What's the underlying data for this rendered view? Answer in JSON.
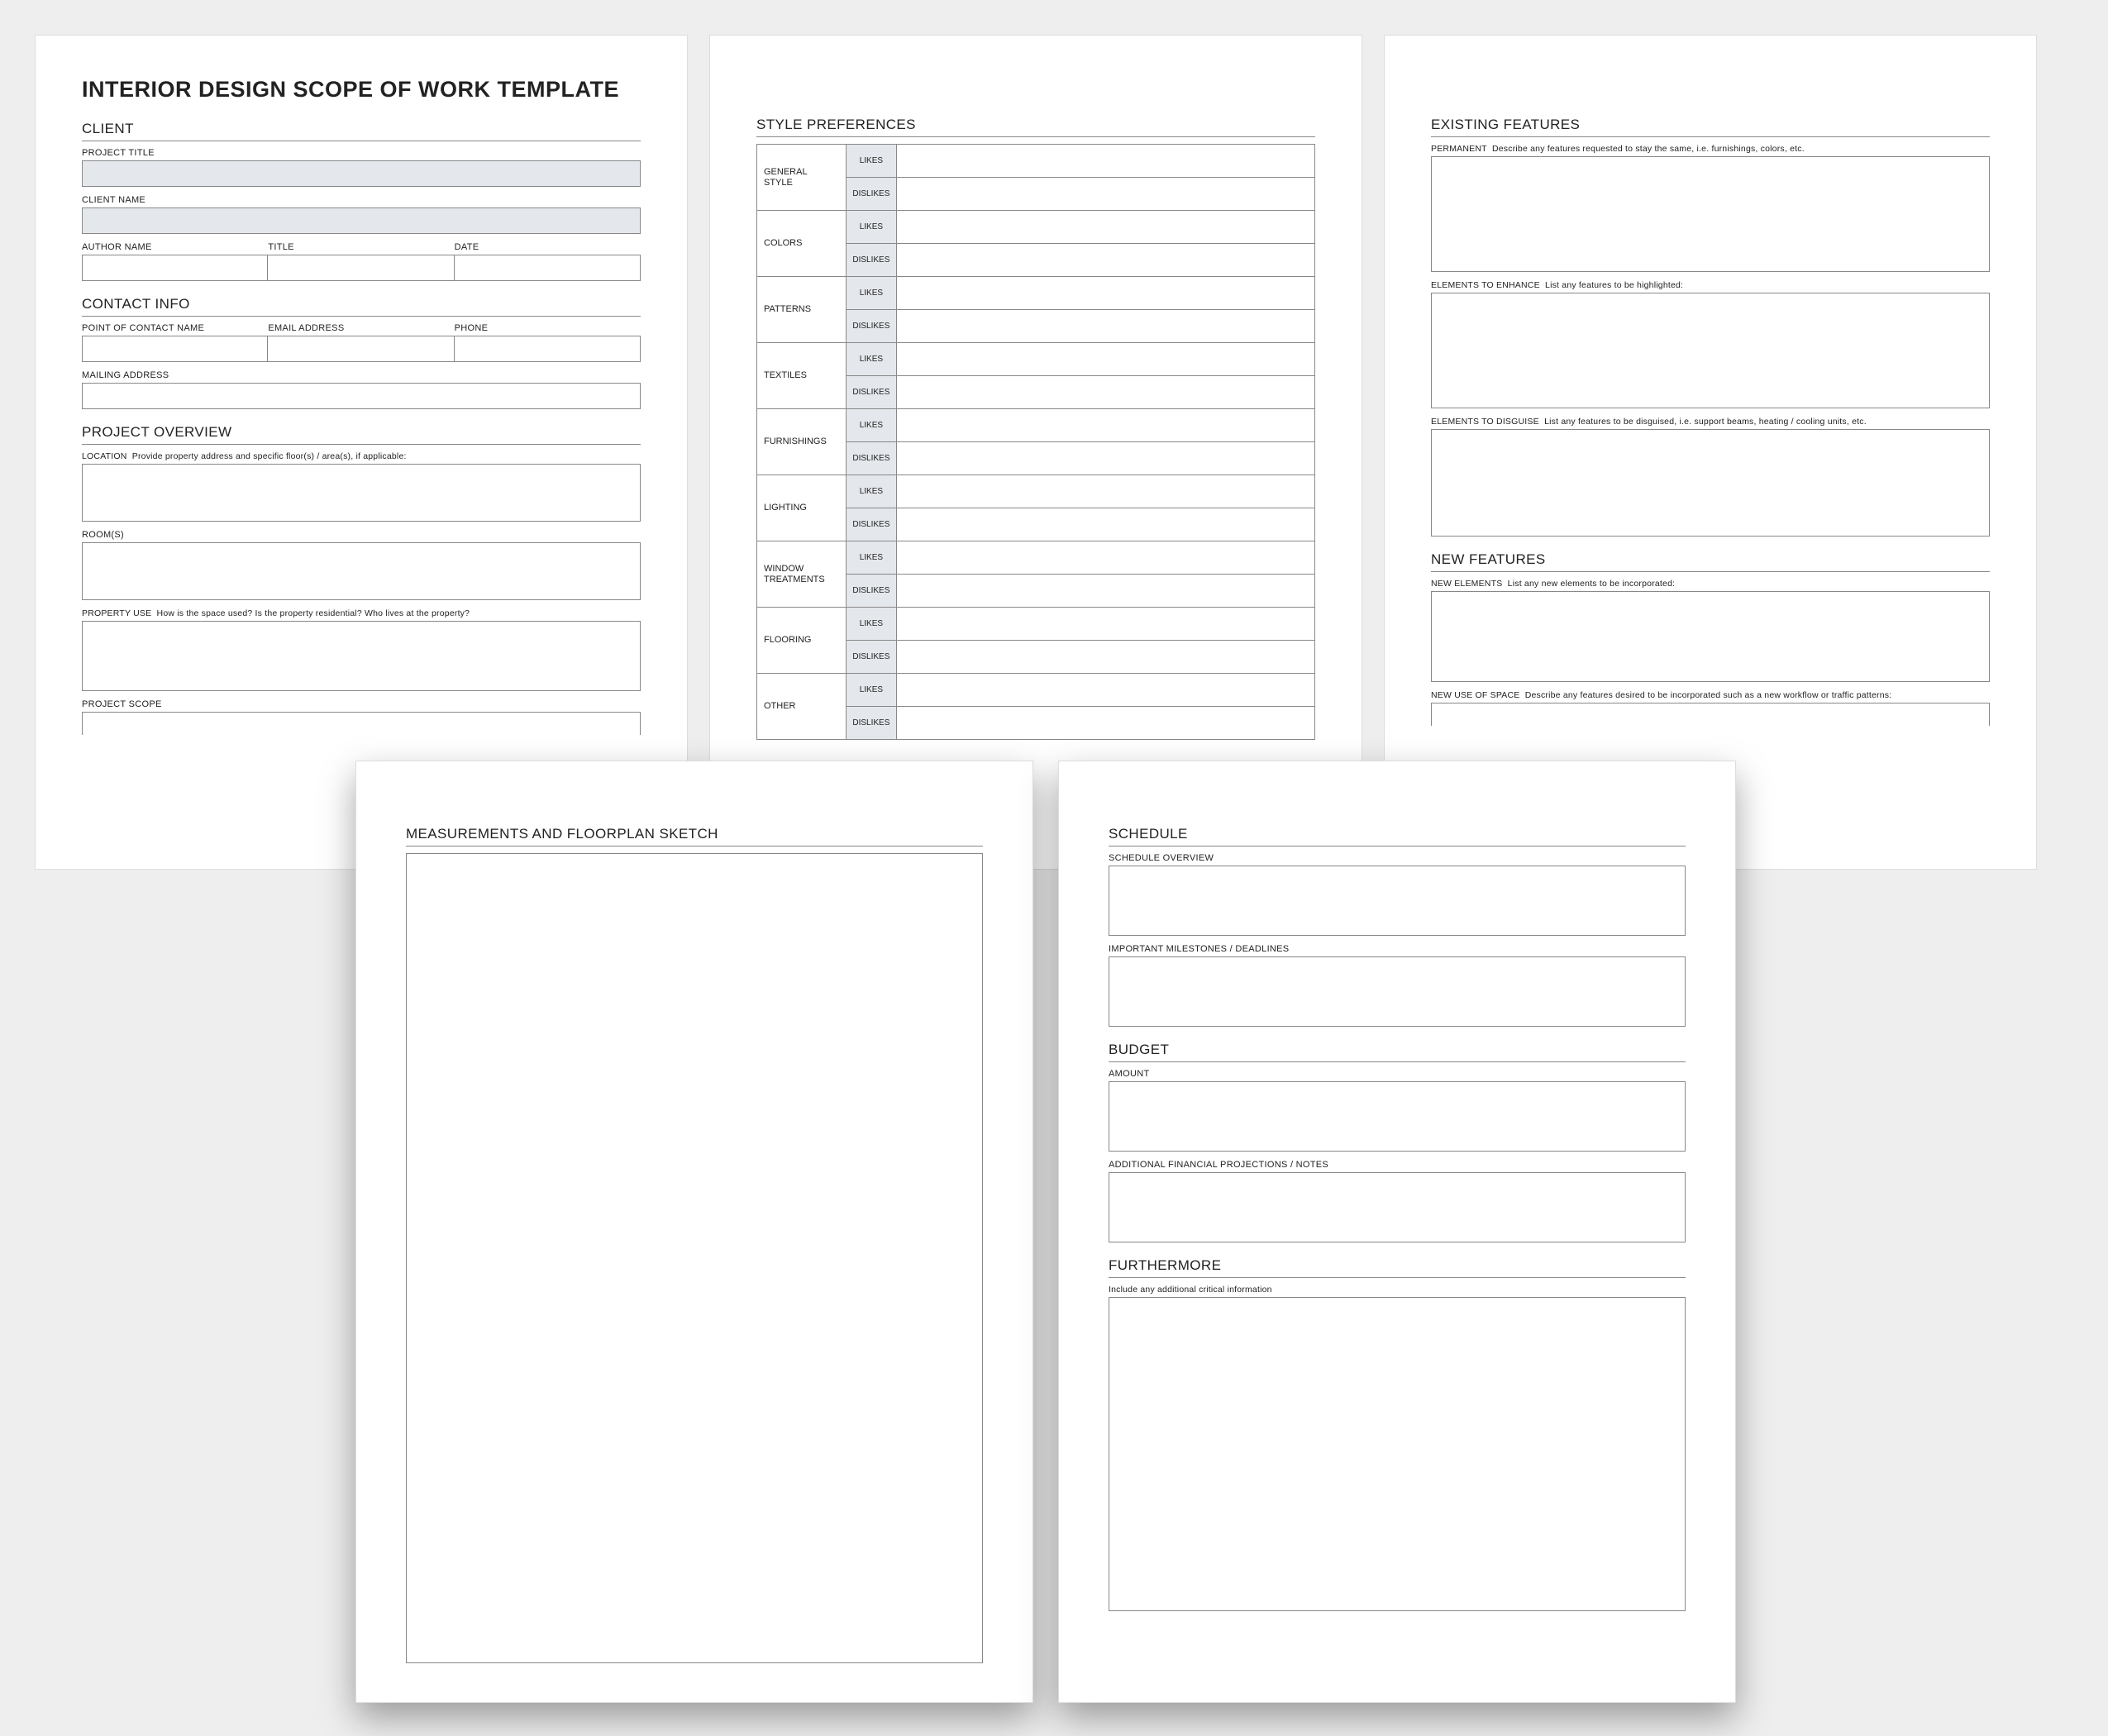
{
  "title": "INTERIOR DESIGN SCOPE OF WORK TEMPLATE",
  "client": {
    "section": "CLIENT",
    "project_title_label": "PROJECT TITLE",
    "client_name_label": "CLIENT NAME",
    "author_name_label": "AUTHOR NAME",
    "title_label": "TITLE",
    "date_label": "DATE"
  },
  "contact": {
    "section": "CONTACT INFO",
    "poc_label": "POINT OF CONTACT NAME",
    "email_label": "EMAIL ADDRESS",
    "phone_label": "PHONE",
    "mailing_label": "MAILING ADDRESS"
  },
  "overview": {
    "section": "PROJECT OVERVIEW",
    "location_label": "LOCATION",
    "location_desc": "Provide property address and specific floor(s) / area(s), if applicable:",
    "rooms_label": "ROOM(S)",
    "property_use_label": "PROPERTY USE",
    "property_use_desc": "How is the space used?  Is the property residential? Who lives at the property?",
    "scope_label": "PROJECT SCOPE"
  },
  "stylePrefs": {
    "section": "STYLE PREFERENCES",
    "likes": "LIKES",
    "dislikes": "DISLIKES",
    "categories": [
      "GENERAL STYLE",
      "COLORS",
      "PATTERNS",
      "TEXTILES",
      "FURNISHINGS",
      "LIGHTING",
      "WINDOW TREATMENTS",
      "FLOORING",
      "OTHER"
    ]
  },
  "existing": {
    "section": "EXISTING FEATURES",
    "permanent_label": "PERMANENT",
    "permanent_desc": "Describe any features requested to stay the same, i.e. furnishings, colors, etc.",
    "enhance_label": "ELEMENTS TO ENHANCE",
    "enhance_desc": "List any features to be highlighted:",
    "disguise_label": "ELEMENTS TO DISGUISE",
    "disguise_desc": "List any features to be disguised, i.e. support beams, heating / cooling units, etc."
  },
  "newFeatures": {
    "section": "NEW FEATURES",
    "elements_label": "NEW ELEMENTS",
    "elements_desc": "List any new elements to be incorporated:",
    "useofspace_label": "NEW USE OF SPACE",
    "useofspace_desc": "Describe any features desired to be incorporated such as a new workflow or traffic patterns:"
  },
  "measurements": {
    "section": "MEASUREMENTS AND FLOORPLAN SKETCH"
  },
  "schedule": {
    "section": "SCHEDULE",
    "overview_label": "SCHEDULE OVERVIEW",
    "milestones_label": "IMPORTANT MILESTONES / DEADLINES"
  },
  "budget": {
    "section": "BUDGET",
    "amount_label": "AMOUNT",
    "notes_label": "ADDITIONAL FINANCIAL PROJECTIONS / NOTES"
  },
  "furthermore": {
    "section": "FURTHERMORE",
    "desc": "Include any additional critical information"
  }
}
